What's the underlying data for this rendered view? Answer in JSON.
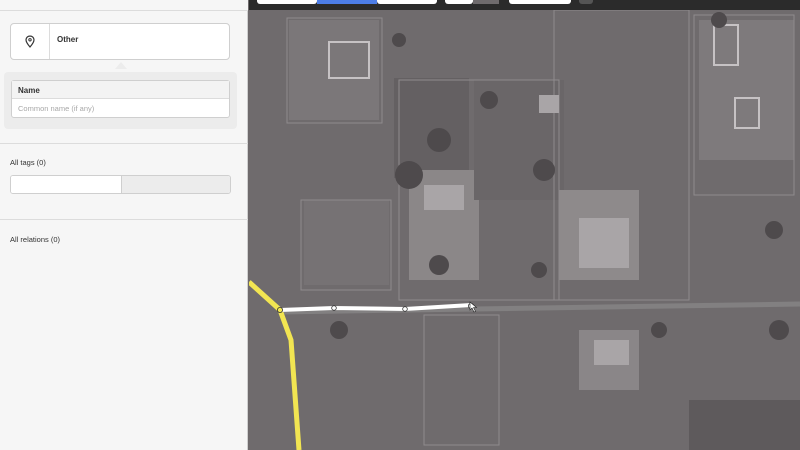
{
  "preset": {
    "name": "Other",
    "icon": "map-marker-icon"
  },
  "fields": [
    {
      "label": "Name",
      "placeholder": "Common name (if any)",
      "value": ""
    }
  ],
  "tags": {
    "title": "All tags (0)"
  },
  "relations": {
    "title": "All relations (0)"
  },
  "colors": {
    "road": "#f2e552",
    "way": "#ffffff",
    "accent": "#4d7ee8"
  }
}
